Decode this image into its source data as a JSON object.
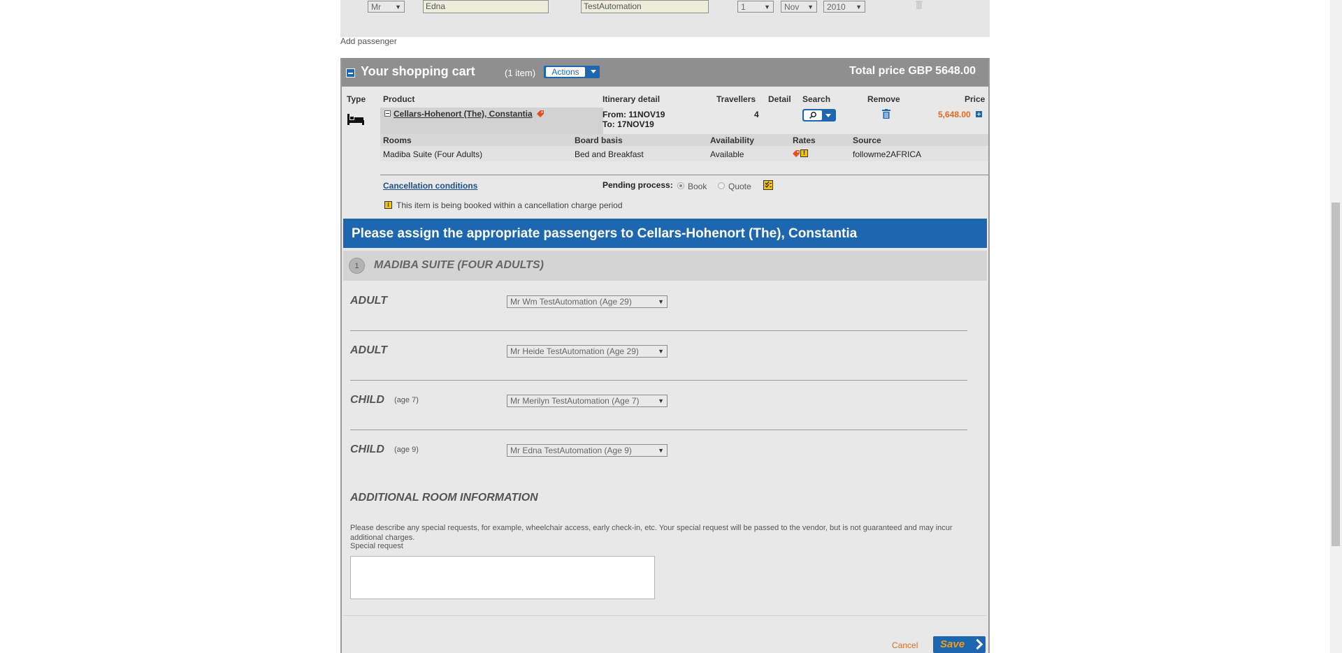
{
  "passenger_row": {
    "title": "Mr",
    "first_name": "Edna",
    "last_name": "TestAutomation",
    "dob_day": "1",
    "dob_month": "Nov",
    "dob_year": "2010"
  },
  "add_passenger_label": "Add passenger",
  "cart": {
    "title": "Your shopping cart",
    "count": "(1 item)",
    "actions_label": "Actions",
    "total": "Total price GBP 5648.00",
    "columns": {
      "type": "Type",
      "product": "Product",
      "itinerary": "Itinerary detail",
      "travellers": "Travellers",
      "detail": "Detail",
      "search": "Search",
      "remove": "Remove",
      "price": "Price"
    },
    "item": {
      "product_name": "Cellars-Hohenort (The), Constantia",
      "from": "From: 11NOV19",
      "to": "To: 17NOV19",
      "travellers": "4",
      "price": "5,648.00"
    },
    "rooms_columns": {
      "rooms": "Rooms",
      "board": "Board basis",
      "availability": "Availability",
      "rates": "Rates",
      "source": "Source"
    },
    "room_row": {
      "room": "Madiba Suite (Four Adults)",
      "board": "Bed and Breakfast",
      "availability": "Available",
      "source": "followme2AFRICA"
    },
    "cancellation_link": "Cancellation conditions",
    "pending_label": "Pending process:",
    "book_label": "Book",
    "quote_label": "Quote",
    "warning_text": "This item is being booked within a cancellation charge period"
  },
  "assign": {
    "title": "Please assign the appropriate passengers to Cellars-Hohenort (The), Constantia",
    "room_number": "1",
    "room_name": "MADIBA SUITE (FOUR ADULTS)",
    "passengers": [
      {
        "type": "ADULT",
        "age": "",
        "selected": "Mr Wm TestAutomation (Age 29)"
      },
      {
        "type": "ADULT",
        "age": "",
        "selected": "Mr Heide TestAutomation (Age 29)"
      },
      {
        "type": "CHILD",
        "age": "(age 7)",
        "selected": "Mr Merilyn TestAutomation (Age 7)"
      },
      {
        "type": "CHILD",
        "age": "(age 9)",
        "selected": "Mr Edna TestAutomation (Age 9)"
      }
    ],
    "additional_title": "ADDITIONAL ROOM INFORMATION",
    "special_desc": "Please describe any special requests, for example, wheelchair access, early check-in, etc. Your special request will be passed to the vendor, but is not guaranteed and may incur additional charges.",
    "special_label": "Special request",
    "special_value": "",
    "cancel_label": "Cancel",
    "save_label": "Save"
  },
  "colors": {
    "brand_blue": "#1d67b1",
    "accent_orange": "#e06a1b",
    "header_grey": "#8f8f8f"
  }
}
